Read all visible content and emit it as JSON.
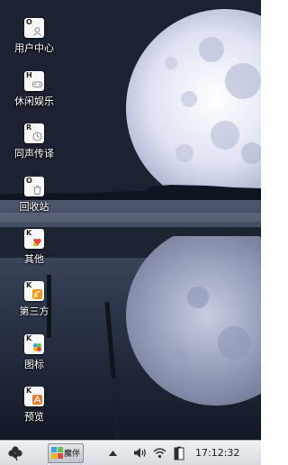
{
  "desktop": {
    "icons": [
      {
        "label": "用户中心",
        "letter": "O",
        "icon": "user-center-icon"
      },
      {
        "label": "休闲娱乐",
        "letter": "H",
        "icon": "gamepad-icon"
      },
      {
        "label": "同声传译",
        "letter": "R",
        "icon": "translate-icon"
      },
      {
        "label": "回收站",
        "letter": "O",
        "icon": "recycle-bin-icon"
      },
      {
        "label": "其他",
        "letter": "K",
        "icon": "other-apps-icon"
      },
      {
        "label": "第三方",
        "letter": "K",
        "icon": "third-party-icon"
      },
      {
        "label": "图标",
        "letter": "K",
        "icon": "icon-pack-icon"
      },
      {
        "label": "预览",
        "letter": "K",
        "icon": "preview-icon"
      }
    ]
  },
  "taskbar": {
    "start_icon": "clover-start-icon",
    "task_label": "魔伴",
    "clock": "17:12:32",
    "tray_icons": [
      "volume-icon",
      "wifi-icon",
      "battery-icon"
    ]
  },
  "colors": {
    "taskbar_bg": "#e2e5e8",
    "desktop_sky": "#1d2435",
    "moon": "#d6dbee"
  }
}
